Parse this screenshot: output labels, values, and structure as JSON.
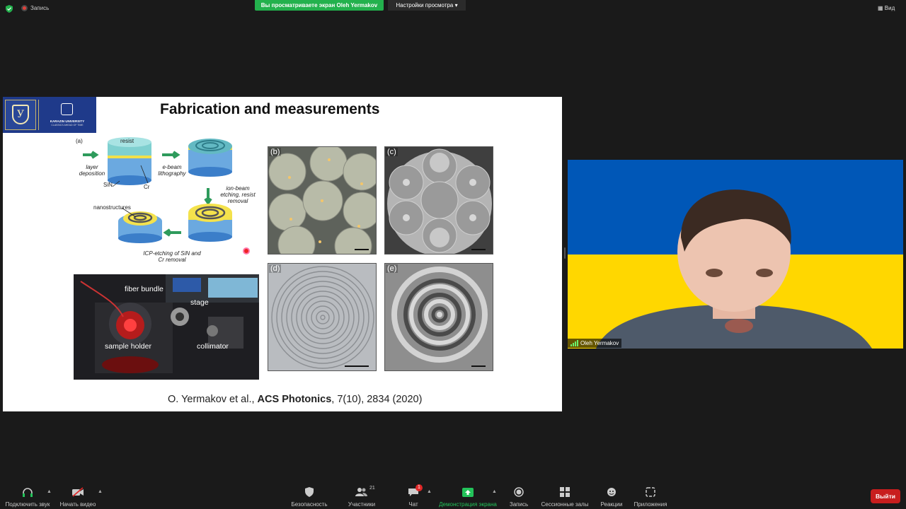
{
  "topbar": {
    "recording_label": "Запись",
    "share_banner": "Вы просматриваете экран Oleh Yermakov",
    "view_settings": "Настройки просмотра",
    "view_button": "Вид"
  },
  "slide": {
    "title": "Fabrication and measurements",
    "logo": {
      "university": "KARAZIN UNIVERSITY",
      "tagline": "CLASSICS AHEAD OF TIME"
    },
    "fabrication": {
      "panel_label": "(a)",
      "resist": "resist",
      "sin": "SiN",
      "cr": "Cr",
      "nanostructures": "nanostructures",
      "step_deposition": "layer deposition",
      "step_ebeam": "e-beam lithography",
      "step_ionbeam": "ion-beam etching, resist removal",
      "step_icp": "ICP-etching of SiN and Cr removal"
    },
    "photo_labels": {
      "fiber": "fiber bundle",
      "stage": "stage",
      "holder": "sample holder",
      "collimator": "collimator"
    },
    "sem_panels": [
      "(b)",
      "(c)",
      "(d)",
      "(e)"
    ],
    "citation": {
      "authors": "O. Yermakov et al., ",
      "journal": "ACS Photonics",
      "ref": ", 7(10), 2834 (2020)"
    }
  },
  "video": {
    "participant_name": "Oleh Yermakov",
    "flag_colors": [
      "#0057b7",
      "#ffd700"
    ]
  },
  "toolbar": {
    "audio": "Подключить звук",
    "video": "Начать видео",
    "security": "Безопасность",
    "participants": "Участники",
    "participants_count": "21",
    "chat": "Чат",
    "chat_unread": "1",
    "share": "Демонстрация экрана",
    "record": "Запись",
    "breakout": "Сессионные залы",
    "reactions": "Реакции",
    "apps": "Приложения",
    "leave": "Выйти"
  }
}
